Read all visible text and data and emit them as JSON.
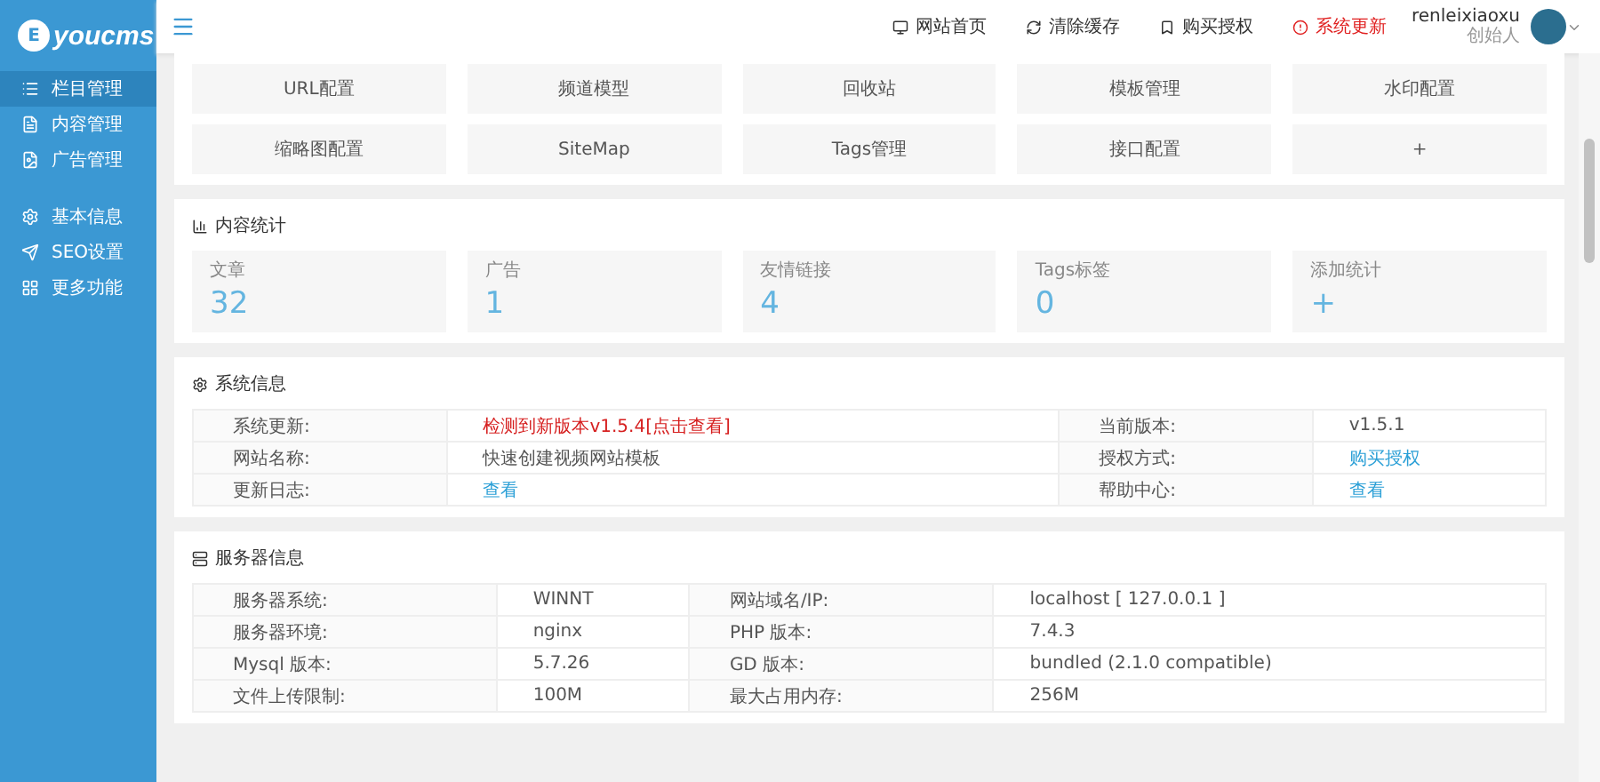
{
  "logo": {
    "mark": "E",
    "text": "youcms"
  },
  "sidebar": {
    "groups": [
      {
        "items": [
          {
            "label": "栏目管理",
            "selected": true
          },
          {
            "label": "内容管理",
            "selected": false
          },
          {
            "label": "广告管理",
            "selected": false
          }
        ]
      },
      {
        "items": [
          {
            "label": "基本信息",
            "selected": false
          },
          {
            "label": "SEO设置",
            "selected": false
          },
          {
            "label": "更多功能",
            "selected": false
          }
        ]
      }
    ]
  },
  "topbar": {
    "links": [
      {
        "label": "网站首页",
        "alert": false
      },
      {
        "label": "清除缓存",
        "alert": false
      },
      {
        "label": "购买授权",
        "alert": false
      },
      {
        "label": "系统更新",
        "alert": true
      }
    ],
    "user": {
      "name": "renleixiaoxu",
      "role": "创始人"
    }
  },
  "quick_links": [
    "URL配置",
    "频道模型",
    "回收站",
    "模板管理",
    "水印配置",
    "缩略图配置",
    "SiteMap",
    "Tags管理",
    "接口配置",
    "+"
  ],
  "stats": {
    "title": "内容统计",
    "items": [
      {
        "label": "文章",
        "value": "32"
      },
      {
        "label": "广告",
        "value": "1"
      },
      {
        "label": "友情链接",
        "value": "4"
      },
      {
        "label": "Tags标签",
        "value": "0"
      },
      {
        "label": "添加统计",
        "value": "+"
      }
    ]
  },
  "system_info": {
    "title": "系统信息",
    "rows": [
      {
        "cells": [
          {
            "label": "系统更新:",
            "value": "检测到新版本v1.5.4[点击查看]",
            "kind": "alert"
          },
          {
            "label": "当前版本:",
            "value": "v1.5.1",
            "kind": "text"
          }
        ]
      },
      {
        "cells": [
          {
            "label": "网站名称:",
            "value": "快速创建视频网站模板",
            "kind": "text"
          },
          {
            "label": "授权方式:",
            "value": "购买授权",
            "kind": "link"
          }
        ]
      },
      {
        "cells": [
          {
            "label": "更新日志:",
            "value": "查看",
            "kind": "link"
          },
          {
            "label": "帮助中心:",
            "value": "查看",
            "kind": "link"
          }
        ]
      }
    ]
  },
  "server_info": {
    "title": "服务器信息",
    "rows": [
      {
        "cells": [
          {
            "label": "服务器系统:",
            "value": "WINNT"
          },
          {
            "label": "网站域名/IP:",
            "value": "localhost [ 127.0.0.1 ]"
          }
        ]
      },
      {
        "cells": [
          {
            "label": "服务器环境:",
            "value": "nginx"
          },
          {
            "label": "PHP 版本:",
            "value": "7.4.3"
          }
        ]
      },
      {
        "cells": [
          {
            "label": "Mysql 版本:",
            "value": "5.7.26"
          },
          {
            "label": "GD 版本:",
            "value": "bundled (2.1.0 compatible)"
          }
        ]
      },
      {
        "cells": [
          {
            "label": "文件上传限制:",
            "value": "100M"
          },
          {
            "label": "最大占用内存:",
            "value": "256M"
          }
        ]
      }
    ]
  }
}
